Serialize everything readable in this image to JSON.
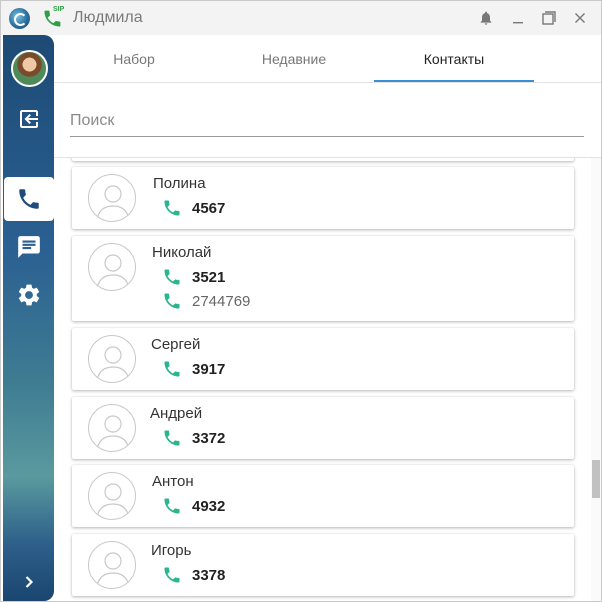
{
  "window": {
    "title": "Людмила",
    "sip_label": "SIP"
  },
  "tabs": [
    {
      "label": "Набор",
      "active": false
    },
    {
      "label": "Недавние",
      "active": false
    },
    {
      "label": "Контакты",
      "active": true
    }
  ],
  "search": {
    "placeholder": "Поиск",
    "value": ""
  },
  "contacts": [
    {
      "name": "Полина",
      "numbers": [
        {
          "value": "4567",
          "primary": true
        }
      ]
    },
    {
      "name": "Николай",
      "numbers": [
        {
          "value": "3521",
          "primary": true
        },
        {
          "value": "2744769",
          "primary": false
        }
      ]
    },
    {
      "name": "Сергей",
      "numbers": [
        {
          "value": "3917",
          "primary": true
        }
      ]
    },
    {
      "name": "Андрей",
      "numbers": [
        {
          "value": "3372",
          "primary": true
        }
      ]
    },
    {
      "name": "Антон",
      "numbers": [
        {
          "value": "4932",
          "primary": true
        }
      ]
    },
    {
      "name": "Игорь",
      "numbers": [
        {
          "value": "3378",
          "primary": true
        }
      ]
    }
  ],
  "sidebar": {
    "items": [
      {
        "icon": "logout-icon"
      },
      {
        "icon": "phone-icon",
        "active": true
      },
      {
        "icon": "chat-icon"
      },
      {
        "icon": "gear-icon"
      },
      {
        "icon": "chevron-right-icon"
      }
    ]
  },
  "colors": {
    "accent": "#3a8fd4",
    "phone_green": "#2bb58f",
    "sidebar_dark": "#1d4a75",
    "active_icon": "#1e4d7b"
  }
}
